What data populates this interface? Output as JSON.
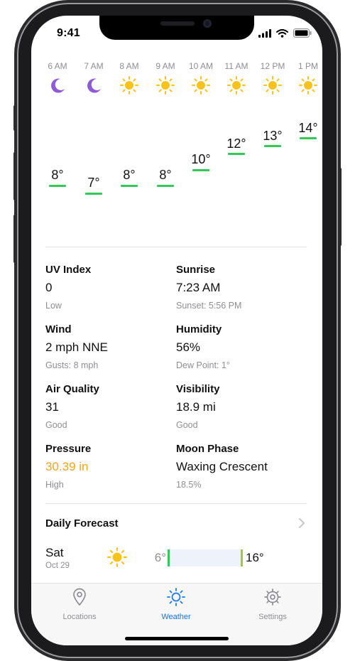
{
  "status_bar": {
    "time": "9:41"
  },
  "hourly": [
    {
      "hour": "6 AM",
      "icon": "moon-icon",
      "temp": "8°"
    },
    {
      "hour": "7 AM",
      "icon": "moon-icon",
      "temp": "7°"
    },
    {
      "hour": "8 AM",
      "icon": "sun-icon",
      "temp": "8°"
    },
    {
      "hour": "9 AM",
      "icon": "sun-icon",
      "temp": "8°"
    },
    {
      "hour": "10 AM",
      "icon": "sun-icon",
      "temp": "10°"
    },
    {
      "hour": "11 AM",
      "icon": "sun-icon",
      "temp": "12°"
    },
    {
      "hour": "12 PM",
      "icon": "sun-icon",
      "temp": "13°"
    },
    {
      "hour": "1 PM",
      "icon": "sun-icon",
      "temp": "14°"
    }
  ],
  "details": {
    "uv": {
      "title": "UV Index",
      "value": "0",
      "sub": "Low"
    },
    "sunrise": {
      "title": "Sunrise",
      "value": "7:23 AM",
      "sub": "Sunset: 5:56 PM"
    },
    "wind": {
      "title": "Wind",
      "value": "2 mph NNE",
      "sub": "Gusts: 8 mph"
    },
    "humidity": {
      "title": "Humidity",
      "value": "56%",
      "sub": "Dew Point: 1°"
    },
    "air_quality": {
      "title": "Air Quality",
      "value": "31",
      "sub": "Good"
    },
    "visibility": {
      "title": "Visibility",
      "value": "18.9 mi",
      "sub": "Good"
    },
    "pressure": {
      "title": "Pressure",
      "value": "30.39 in",
      "sub": "High",
      "value_color": "#f2a41c"
    },
    "moon": {
      "title": "Moon Phase",
      "value": "Waxing Crescent",
      "sub": "18.5%"
    }
  },
  "daily": {
    "title": "Daily Forecast",
    "days": [
      {
        "day": "Sat",
        "date": "Oct 29",
        "icon": "sun-icon",
        "low": "6°",
        "high": "16°"
      }
    ]
  },
  "tabs": [
    {
      "label": "Locations",
      "icon": "location-pin-icon",
      "active": false
    },
    {
      "label": "Weather",
      "icon": "sun-icon",
      "active": true
    },
    {
      "label": "Settings",
      "icon": "gear-icon",
      "active": false
    }
  ],
  "colors": {
    "accent": "#1a73e8",
    "temp_bar": "#34c759",
    "sun": "#f7c21c",
    "moon": "#8e5bd6",
    "pressure": "#f2a41c"
  }
}
